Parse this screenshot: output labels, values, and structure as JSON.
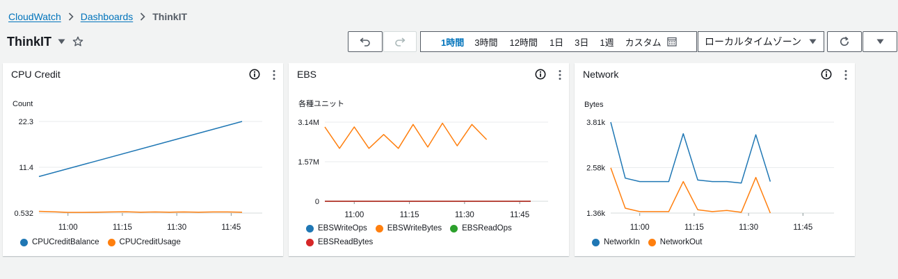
{
  "breadcrumb": {
    "items": [
      "CloudWatch",
      "Dashboards"
    ],
    "current": "ThinkIT"
  },
  "page": {
    "title": "ThinkIT"
  },
  "toolbar": {
    "ranges": [
      "1時間",
      "3時間",
      "12時間",
      "1日",
      "3日",
      "1週",
      "カスタム"
    ],
    "active_range": "1時間",
    "timezone": "ローカルタイムゾーン"
  },
  "colors": {
    "blue": "#1f77b4",
    "orange": "#ff7f0e",
    "green": "#2ca02c",
    "red": "#d62728",
    "link": "#0073bb"
  },
  "widgets": [
    {
      "title": "CPU Credit",
      "chart_data": {
        "type": "line",
        "ylabel": "Count",
        "yticks": [
          "22.3",
          "11.4",
          "0.532"
        ],
        "ylim": [
          0.532,
          22.3
        ],
        "x": [
          "10:52",
          "10:56",
          "11:00",
          "11:04",
          "11:08",
          "11:12",
          "11:16",
          "11:20",
          "11:24",
          "11:28",
          "11:32",
          "11:36",
          "11:40",
          "11:44",
          "11:48"
        ],
        "xticks": [
          "11:00",
          "11:15",
          "11:30",
          "11:45"
        ],
        "series": [
          {
            "name": "CPUCreditBalance",
            "color": "#1f77b4",
            "values": [
              9.2,
              null,
              null,
              null,
              null,
              null,
              null,
              null,
              null,
              null,
              null,
              null,
              null,
              null,
              22.3
            ]
          },
          {
            "name": "CPUCreditUsage",
            "color": "#ff7f0e",
            "values": [
              0.95,
              0.85,
              0.7,
              0.7,
              0.75,
              0.8,
              0.85,
              0.75,
              0.8,
              0.75,
              0.8,
              0.75,
              0.8,
              0.8,
              0.75
            ]
          }
        ]
      }
    },
    {
      "title": "EBS",
      "chart_data": {
        "type": "line",
        "ylabel": "各種ユニット",
        "yticks": [
          "3.14M",
          "1.57M",
          "0"
        ],
        "ylim": [
          0,
          3.14
        ],
        "x": [
          "10:52",
          "10:56",
          "11:00",
          "11:04",
          "11:08",
          "11:12",
          "11:16",
          "11:20",
          "11:24",
          "11:28",
          "11:32",
          "11:36",
          "11:40",
          "11:44",
          "11:48"
        ],
        "xticks": [
          "11:00",
          "11:15",
          "11:30",
          "11:45"
        ],
        "series": [
          {
            "name": "EBSWriteOps",
            "color": "#1f77b4",
            "values": [
              0,
              0,
              0,
              0,
              0,
              0,
              0,
              0,
              0,
              0,
              0,
              0,
              0,
              0,
              0
            ]
          },
          {
            "name": "EBSWriteBytes",
            "color": "#ff7f0e",
            "values": [
              2.95,
              2.1,
              2.95,
              2.1,
              2.65,
              2.1,
              3.05,
              2.15,
              3.1,
              2.2,
              3.05,
              2.45,
              null,
              null,
              null
            ]
          },
          {
            "name": "EBSReadOps",
            "color": "#2ca02c",
            "values": [
              0,
              0,
              0,
              0,
              0,
              0,
              0,
              0,
              0,
              0,
              0,
              0,
              0,
              0,
              0
            ]
          },
          {
            "name": "EBSReadBytes",
            "color": "#d62728",
            "values": [
              0,
              0,
              0,
              0,
              0,
              0,
              0,
              0,
              0,
              0,
              0,
              0,
              0,
              0,
              0
            ]
          }
        ]
      }
    },
    {
      "title": "Network",
      "chart_data": {
        "type": "line",
        "ylabel": "Bytes",
        "yticks": [
          "3.81k",
          "2.58k",
          "1.36k"
        ],
        "ylim": [
          1.36,
          3.81
        ],
        "x": [
          "10:52",
          "10:56",
          "11:00",
          "11:04",
          "11:08",
          "11:12",
          "11:16",
          "11:20",
          "11:24",
          "11:28",
          "11:32",
          "11:36",
          "11:40",
          "11:44",
          "11:48"
        ],
        "xticks": [
          "11:00",
          "11:15",
          "11:30",
          "11:45"
        ],
        "series": [
          {
            "name": "NetworkIn",
            "color": "#1f77b4",
            "values": [
              3.81,
              2.3,
              2.21,
              2.21,
              2.21,
              3.5,
              2.25,
              2.21,
              2.21,
              2.17,
              3.47,
              2.21
            ]
          },
          {
            "name": "NetworkOut",
            "color": "#ff7f0e",
            "values": [
              2.58,
              1.49,
              1.4,
              1.4,
              1.4,
              2.21,
              1.45,
              1.4,
              1.43,
              1.38,
              2.32,
              1.36
            ]
          }
        ]
      }
    }
  ]
}
